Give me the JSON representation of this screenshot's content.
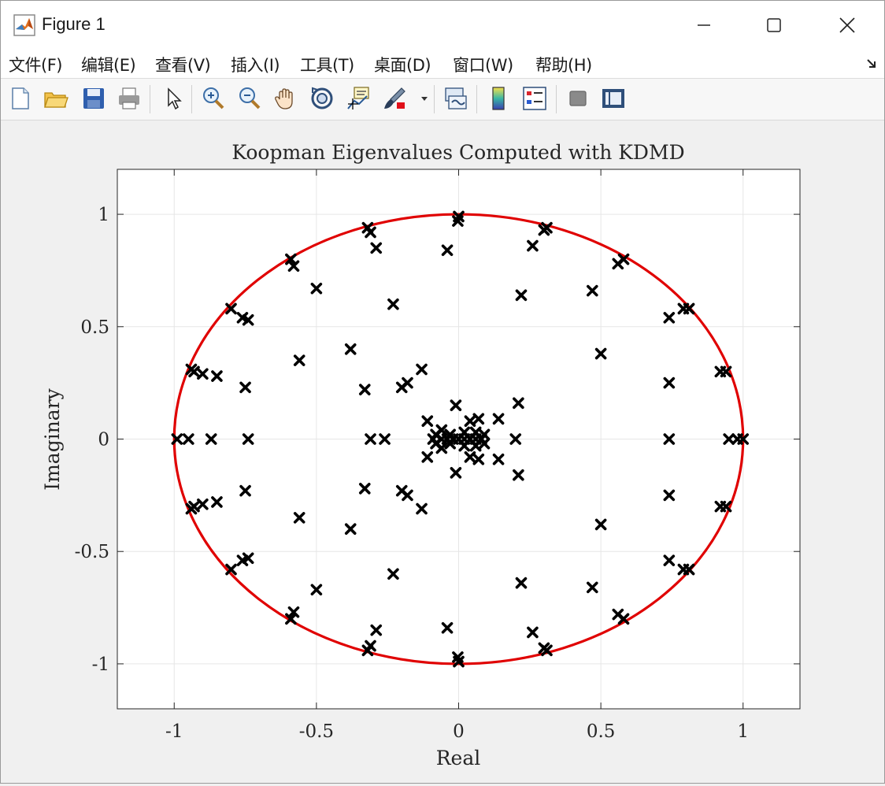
{
  "window": {
    "title": "Figure 1"
  },
  "menu": [
    "文件(F)",
    "编辑(E)",
    "查看(V)",
    "插入(I)",
    "工具(T)",
    "桌面(D)",
    "窗口(W)",
    "帮助(H)"
  ],
  "toolbar_icons": [
    "new-figure-icon",
    "open-file-icon",
    "save-icon",
    "print-icon",
    "pointer-icon",
    "zoom-in-icon",
    "zoom-out-icon",
    "pan-icon",
    "rotate-3d-icon",
    "data-cursor-icon",
    "brush-icon",
    "brush-dropdown-icon",
    "link-plot-icon",
    "colorbar-icon",
    "legend-icon",
    "hide-plot-tools-icon",
    "show-plot-tools-icon"
  ],
  "colors": {
    "circle": "#e00000",
    "marker": "#000000",
    "grid": "#e6e6e6"
  },
  "chart_data": {
    "type": "scatter",
    "title": "Koopman Eigenvalues Computed with KDMD",
    "xlabel": "Real",
    "ylabel": "Imaginary",
    "xlim": [
      -1.2,
      1.2
    ],
    "ylim": [
      -1.2,
      1.2
    ],
    "xticks": [
      -1,
      -0.5,
      0,
      0.5,
      1
    ],
    "yticks": [
      -1,
      -0.5,
      0,
      0.5,
      1
    ],
    "xtick_labels": [
      "-1",
      "-0.5",
      "0",
      "0.5",
      "1"
    ],
    "ytick_labels": [
      "-1",
      "-0.5",
      "0",
      "0.5",
      "1"
    ],
    "grid": true,
    "unit_circle": {
      "center": [
        0,
        0
      ],
      "radius": 1
    },
    "points_upper": [
      [
        0.0,
        0.99
      ],
      [
        -0.003,
        0.97
      ],
      [
        0.31,
        0.94
      ],
      [
        0.3,
        0.93
      ],
      [
        -0.32,
        0.94
      ],
      [
        -0.31,
        0.92
      ],
      [
        -0.29,
        0.85
      ],
      [
        0.26,
        0.86
      ],
      [
        -0.04,
        0.84
      ],
      [
        0.22,
        0.64
      ],
      [
        -0.23,
        0.6
      ],
      [
        0.56,
        0.78
      ],
      [
        0.58,
        0.8
      ],
      [
        -0.59,
        0.8
      ],
      [
        -0.58,
        0.77
      ],
      [
        -0.5,
        0.67
      ],
      [
        0.47,
        0.66
      ],
      [
        0.79,
        0.58
      ],
      [
        0.81,
        0.58
      ],
      [
        -0.8,
        0.58
      ],
      [
        -0.76,
        0.54
      ],
      [
        -0.74,
        0.53
      ],
      [
        0.74,
        0.54
      ],
      [
        0.92,
        0.3
      ],
      [
        0.94,
        0.3
      ],
      [
        -0.94,
        0.31
      ],
      [
        -0.93,
        0.3
      ],
      [
        -0.9,
        0.29
      ],
      [
        -0.85,
        0.28
      ],
      [
        -0.38,
        0.4
      ],
      [
        0.5,
        0.38
      ],
      [
        -0.56,
        0.35
      ],
      [
        -0.13,
        0.31
      ],
      [
        0.74,
        0.25
      ],
      [
        -0.2,
        0.23
      ],
      [
        -0.18,
        0.25
      ],
      [
        -0.33,
        0.22
      ],
      [
        -0.75,
        0.23
      ],
      [
        0.21,
        0.16
      ],
      [
        -0.01,
        0.15
      ],
      [
        0.07,
        0.09
      ],
      [
        0.14,
        0.09
      ],
      [
        -0.11,
        0.08
      ],
      [
        0.04,
        0.08
      ],
      [
        -0.06,
        0.04
      ],
      [
        -0.08,
        0.02
      ],
      [
        0.02,
        0.03
      ],
      [
        0.06,
        0.03
      ],
      [
        -0.03,
        0.02
      ],
      [
        0.09,
        0.02
      ]
    ],
    "points_axis": [
      [
        1.0,
        0.0
      ],
      [
        0.98,
        0.0
      ],
      [
        0.95,
        0.0
      ],
      [
        0.74,
        0.0
      ],
      [
        -0.74,
        0.0
      ],
      [
        -0.87,
        0.0
      ],
      [
        -0.95,
        0.0
      ],
      [
        -0.99,
        0.0
      ],
      [
        0.2,
        0.0
      ],
      [
        -0.26,
        0.0
      ],
      [
        -0.31,
        0.0
      ],
      [
        0.08,
        0.0
      ],
      [
        0.06,
        0.0
      ],
      [
        0.04,
        0.0
      ],
      [
        0.02,
        0.0
      ],
      [
        0.0,
        0.0
      ],
      [
        -0.02,
        0.0
      ],
      [
        -0.04,
        0.0
      ],
      [
        -0.06,
        0.0
      ],
      [
        -0.09,
        0.0
      ]
    ]
  }
}
